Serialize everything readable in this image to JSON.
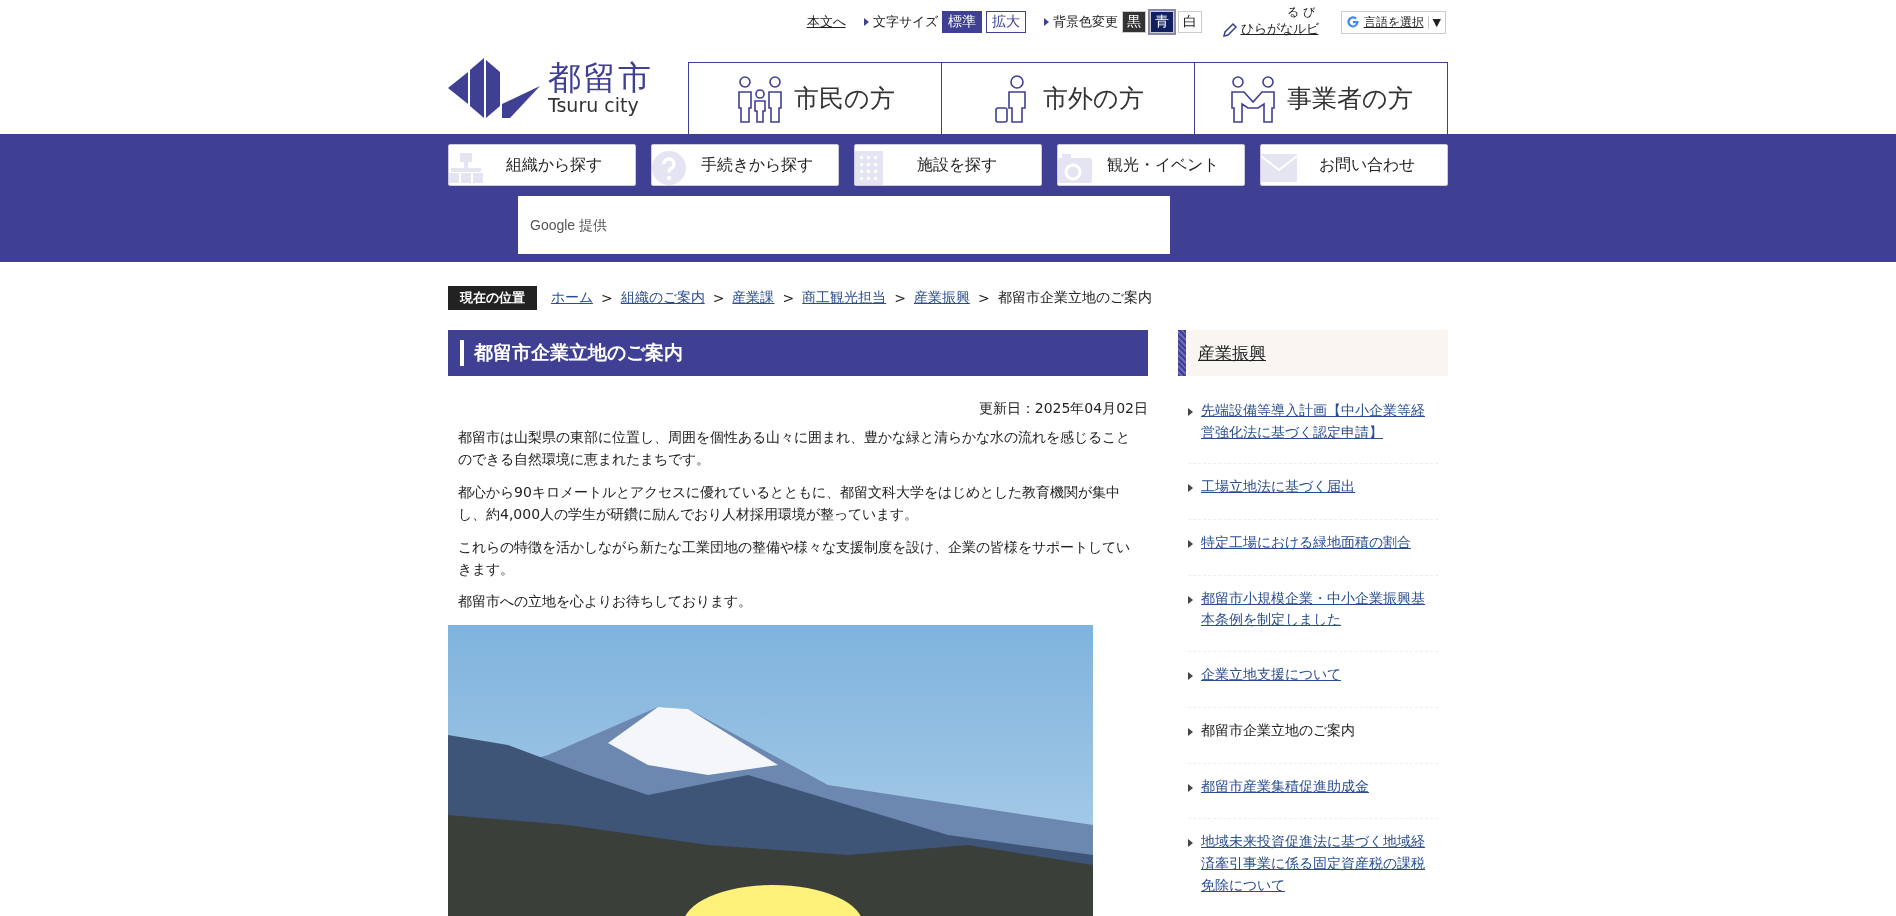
{
  "utility_bar": {
    "skip_link": "本文へ",
    "font_size": {
      "label": "文字サイズ",
      "options": [
        {
          "label": "標準",
          "selected": true
        },
        {
          "label": "拡大",
          "selected": false
        }
      ]
    },
    "background": {
      "label": "背景色変更",
      "options": [
        {
          "label": "黒",
          "kind": "black",
          "selected": false
        },
        {
          "label": "青",
          "kind": "blue",
          "selected": true
        },
        {
          "label": "白",
          "kind": "white",
          "selected": false
        }
      ]
    },
    "ruby": {
      "label": "ひらがなルビ",
      "reading": "るび"
    },
    "translate": {
      "label": "言語を選択",
      "arrow": "▼"
    }
  },
  "logo": {
    "title": "都留市",
    "subtitle": "Tsuru city"
  },
  "audience_tabs": [
    {
      "label": "市民の方",
      "kind": "family"
    },
    {
      "label": "市外の方",
      "kind": "visitor"
    },
    {
      "label": "事業者の方",
      "kind": "business"
    }
  ],
  "nav_buttons": [
    {
      "label": "組織から探す",
      "kind": "org"
    },
    {
      "label": "手続きから探す",
      "kind": "help"
    },
    {
      "label": "施設を探す",
      "kind": "facility"
    },
    {
      "label": "観光・イベント",
      "kind": "camera"
    },
    {
      "label": "お問い合わせ",
      "kind": "mail"
    }
  ],
  "search": {
    "placeholder": "Google 提供"
  },
  "breadcrumb": {
    "label": "現在の位置",
    "items": [
      {
        "text": "ホーム",
        "link": true
      },
      {
        "text": "組織のご案内",
        "link": true
      },
      {
        "text": "産業課",
        "link": true
      },
      {
        "text": "商工観光担当",
        "link": true
      },
      {
        "text": "産業振興",
        "link": true
      },
      {
        "text": "都留市企業立地のご案内",
        "link": false
      }
    ],
    "separator": ">"
  },
  "article": {
    "title": "都留市企業立地のご案内",
    "updated": "更新日：2025年04月02日",
    "paragraphs": [
      "都留市は山梨県の東部に位置し、周囲を個性ある山々に囲まれ、豊かな緑と清らかな水の流れを感じることのできる自然環境に恵まれたまちです。",
      "都心から90キロメートルとアクセスに優れているとともに、都留文科大学をはじめとした教育機関が集中し、約4,000人の学生が研鑽に励んでおり人材採用環境が整っています。",
      "これらの特徴を活かしながら新たな工業団地の整備や様々な支援制度を設け、企業の皆様をサポートしていきます。",
      "都留市への立地を心よりお待ちしております。"
    ]
  },
  "sidebar": {
    "title": "産業振興",
    "items": [
      {
        "label": "先端設備等導入計画【中小企業等経営強化法に基づく認定申請】",
        "current": false
      },
      {
        "label": "工場立地法に基づく届出",
        "current": false
      },
      {
        "label": "特定工場における緑地面積の割合",
        "current": false
      },
      {
        "label": "都留市小規模企業・中小企業振興基本条例を制定しました",
        "current": false
      },
      {
        "label": "企業立地支援について",
        "current": false
      },
      {
        "label": "都留市企業立地のご案内",
        "current": true
      },
      {
        "label": "都留市産業集積促進助成金",
        "current": false
      },
      {
        "label": "地域未来投資促進法に基づく地域経済牽引事業に係る固定資産税の課税免除について",
        "current": false
      }
    ]
  }
}
